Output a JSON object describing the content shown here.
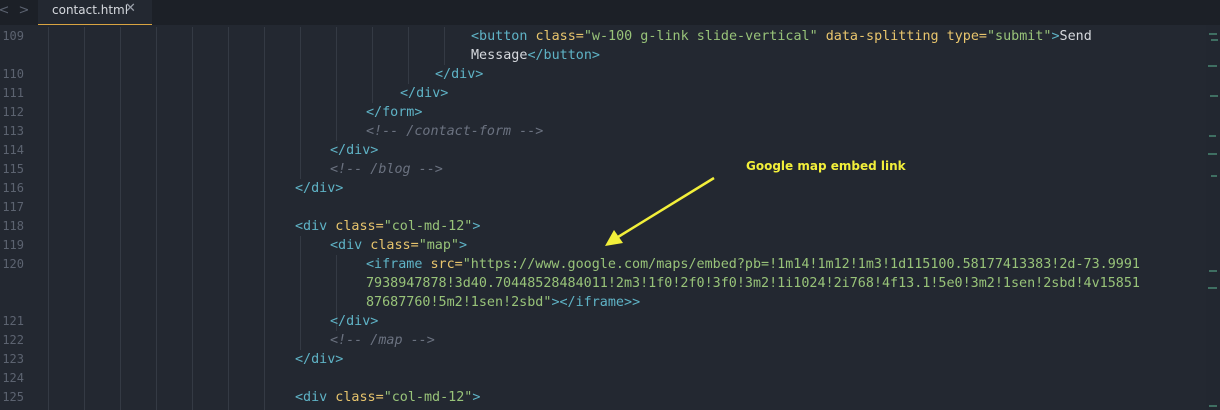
{
  "tabbar": {
    "tab_label": "contact.html",
    "close_glyph": "✕",
    "back_glyph": "<",
    "forward_glyph": ">"
  },
  "gutter": {
    "line_numbers": [
      "109",
      "",
      "110",
      "111",
      "112",
      "113",
      "114",
      "115",
      "116",
      "117",
      "118",
      "119",
      "120",
      "",
      "",
      "121",
      "122",
      "123",
      "124",
      "125"
    ]
  },
  "code": {
    "l109a_tag_open": "<button",
    "l109a_attr1": " class=",
    "l109a_val1": "\"w-100 g-link slide-vertical\"",
    "l109a_attr2": " data-splitting",
    "l109a_attr3": " type=",
    "l109a_val3": "\"submit\"",
    "l109a_gt": ">",
    "l109a_text": "Send",
    "l109b_text": "Message",
    "l109b_close": "</button>",
    "l110": "</div>",
    "l111": "</div>",
    "l112": "</form>",
    "l113": "<!-- /contact-form -->",
    "l114": "</div>",
    "l115": "<!-- /blog -->",
    "l116": "</div>",
    "l118_tag": "<div",
    "l118_attr": " class=",
    "l118_val": "\"col-md-12\"",
    "l118_gt": ">",
    "l119_tag": "<div",
    "l119_attr": " class=",
    "l119_val": "\"map\"",
    "l119_gt": ">",
    "l120a_tag": "<iframe",
    "l120a_attr": " src=",
    "l120a_val": "\"https://www.google.com/maps/embed?pb=!1m14!1m12!1m3!1d115100.58177413383!2d-73.9991",
    "l120b_val": "7938947878!3d40.70448528484011!2m3!1f0!2f0!3f0!3m2!1i1024!2i768!4f13.1!5e0!3m2!1sen!2sbd!4v15851",
    "l120c_val": "87687760!5m2!1sen!2sbd\"",
    "l120c_gt": ">",
    "l120c_close": "</iframe>",
    "l120c_gt2": ">",
    "l121": "</div>",
    "l122": "<!-- /map -->",
    "l123": "</div>",
    "l125_tag": "<div",
    "l125_attr": " class=",
    "l125_val": "\"col-md-12\"",
    "l125_gt": ">"
  },
  "annotation": {
    "label": "Google map embed link"
  },
  "colors": {
    "background": "#232831",
    "tag": "#5fb3c6",
    "attribute": "#e8c56d",
    "string": "#98c379",
    "comment": "#6b7280",
    "annotation": "#f2ef3a"
  }
}
